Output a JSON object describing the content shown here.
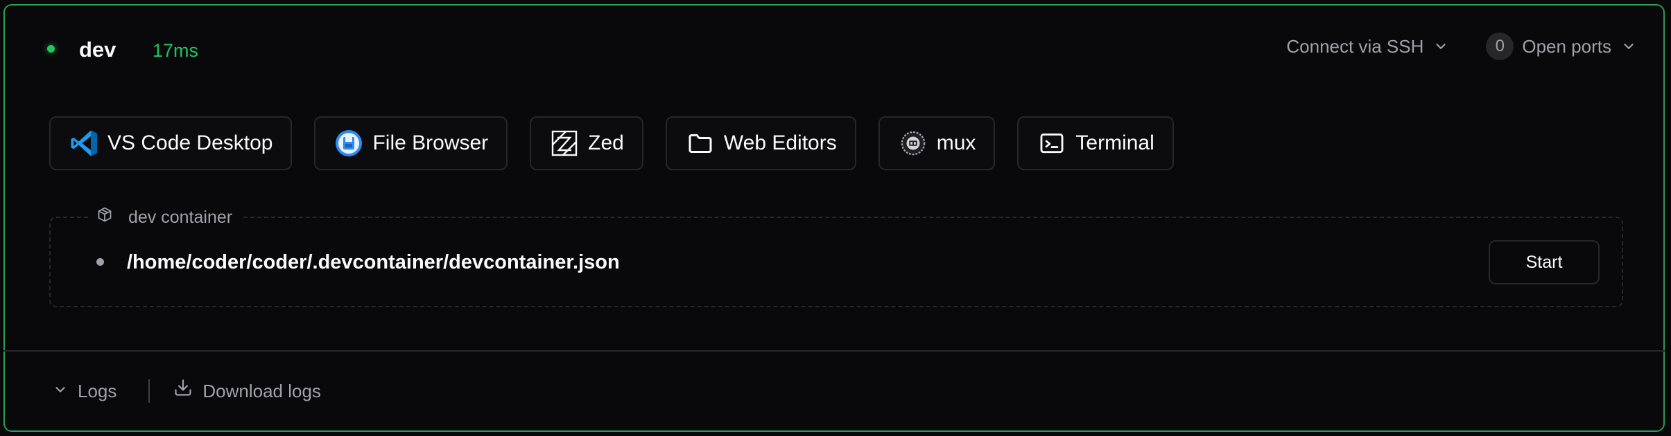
{
  "agent": {
    "name": "dev",
    "latency": "17ms",
    "status_color": "#22c55e"
  },
  "header": {
    "connect_label": "Connect via SSH",
    "ports_count": "0",
    "ports_label": "Open ports"
  },
  "apps": [
    {
      "label": "VS Code Desktop",
      "icon": "vscode-icon"
    },
    {
      "label": "File Browser",
      "icon": "file-browser-icon"
    },
    {
      "label": "Zed",
      "icon": "zed-icon"
    },
    {
      "label": "Web Editors",
      "icon": "folder-icon"
    },
    {
      "label": "mux",
      "icon": "mux-icon"
    },
    {
      "label": "Terminal",
      "icon": "terminal-icon"
    }
  ],
  "devcontainer": {
    "legend": "dev container",
    "path": "/home/coder/coder/.devcontainer/devcontainer.json",
    "start_label": "Start"
  },
  "footer": {
    "logs_label": "Logs",
    "download_label": "Download logs"
  },
  "colors": {
    "accent_border": "#2a9d57",
    "background": "#09090b",
    "muted_text": "#a1a1aa"
  }
}
